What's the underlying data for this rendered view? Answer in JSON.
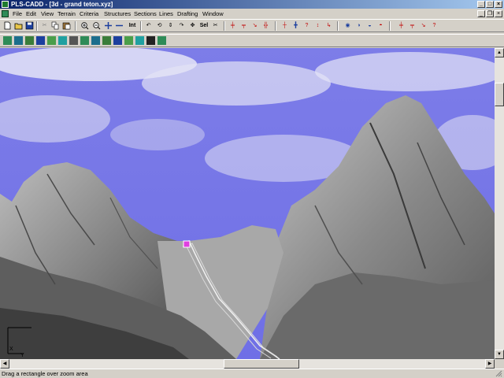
{
  "window": {
    "title": "PLS-CADD - [3d - grand teton.xyz]"
  },
  "menu": [
    "File",
    "Edit",
    "View",
    "Terrain",
    "Criteria",
    "Structures",
    "Sections",
    "Lines",
    "Drafting",
    "Window"
  ],
  "toolbar": {
    "int_label": "Int",
    "sel_label": "Sel"
  },
  "axis_indicator": {
    "x_label": "X",
    "y_label": "Y"
  },
  "status": {
    "text": "Drag a rectangle over zoom area"
  },
  "colors": {
    "titlebar": "#0a246a",
    "sky": "#7777e6",
    "chrome": "#d4d0c8"
  }
}
